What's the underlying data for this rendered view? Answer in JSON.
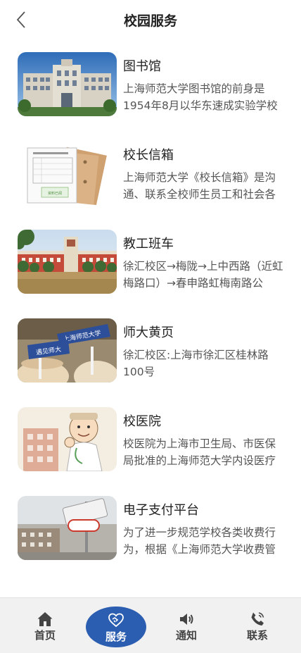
{
  "header": {
    "title": "校园服务"
  },
  "items": [
    {
      "title": "图书馆",
      "desc": "上海师范大学图书馆的前身是1954年8月以华东速成实验学校"
    },
    {
      "title": "校长信箱",
      "desc": "上海师范大学《校长信箱》是沟通、联系全校师生员工和社会各"
    },
    {
      "title": "教工班车",
      "desc": "徐汇校区→梅陇→上中西路（近虹梅路口）→春申路虹梅南路公"
    },
    {
      "title": "师大黄页",
      "desc": "徐汇校区:上海市徐汇区桂林路100号"
    },
    {
      "title": "校医院",
      "desc": "校医院为上海市卫生局、市医保局批准的上海师范大学内设医疗"
    },
    {
      "title": "电子支付平台",
      "desc": "为了进一步规范学校各类收费行为，根据《上海师范大学收费管"
    }
  ],
  "thumbs": {
    "mailbox_sign": "资料已阅",
    "bus_badge_top": "上海师范大学",
    "bus_badge_bottom": "遇见师大"
  },
  "tabbar": {
    "home": "首页",
    "service": "服务",
    "notice": "通知",
    "contact": "联系"
  },
  "colors": {
    "accent": "#2b5db0",
    "tabbar_bg": "#f1f1f1"
  }
}
